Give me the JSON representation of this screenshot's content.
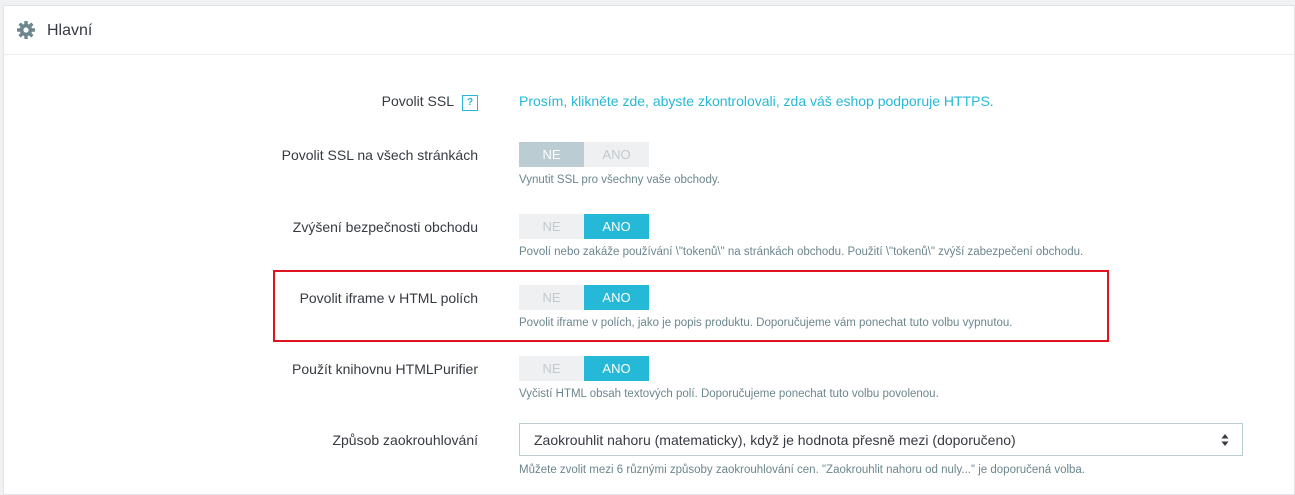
{
  "panel": {
    "title": "Hlavní",
    "icon": "gear-icon"
  },
  "rows": {
    "ssl": {
      "label": "Povolit SSL",
      "help": "?",
      "link_text": "Prosím, klikněte zde, abyste zkontrolovali, zda váš eshop podporuje HTTPS."
    },
    "ssl_all": {
      "label": "Povolit SSL na všech stránkách",
      "no": "NE",
      "yes": "ANO",
      "selected": "NE",
      "hint": "Vynutit SSL pro všechny vaše obchody."
    },
    "security": {
      "label": "Zvýšení bezpečnosti obchodu",
      "no": "NE",
      "yes": "ANO",
      "selected": "ANO",
      "hint": "Povolí nebo zakáže používání \\\"tokenů\\\" na stránkách obchodu. Použití \\\"tokenů\\\" zvýší zabezpečení obchodu."
    },
    "iframe": {
      "label": "Povolit iframe v HTML polích",
      "no": "NE",
      "yes": "ANO",
      "selected": "ANO",
      "hint": "Povolit iframe v polích, jako je popis produktu. Doporučujeme vám ponechat tuto volbu vypnutou."
    },
    "purifier": {
      "label": "Použít knihovnu HTMLPurifier",
      "no": "NE",
      "yes": "ANO",
      "selected": "ANO",
      "hint": "Vyčistí HTML obsah textových polí. Doporučujeme ponechat tuto volbu povolenou."
    },
    "rounding": {
      "label": "Způsob zaokrouhlování",
      "value": "Zaokrouhlit nahoru (matematicky), když je hodnota přesně mezi (doporučeno)",
      "hint": "Můžete zvolit mezi 6 různými způsoby zaokrouhlování cen. \"Zaokrouhlit nahoru od nuly...\" je doporučená volba."
    }
  },
  "colors": {
    "accent": "#25b9d7",
    "switch_off_active": "#bbcdd2",
    "highlight": "#e0141e"
  }
}
